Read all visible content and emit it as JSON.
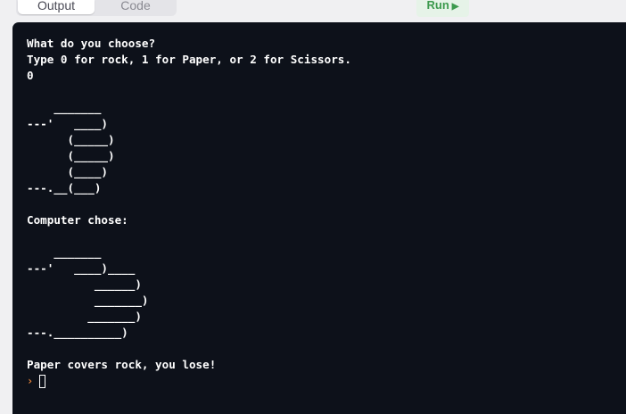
{
  "tabs": {
    "output_label": "Output",
    "code_label": "Code"
  },
  "run_button": {
    "label": "Run",
    "icon": "play-icon"
  },
  "console": {
    "background": "#0d111a",
    "lines": [
      "What do you choose?",
      "Type 0 for rock, 1 for Paper, or 2 for Scissors.",
      "0",
      "",
      "    _______",
      "---'   ____)",
      "      (_____)",
      "      (_____)",
      "      (____)",
      "---.__(___)",
      "",
      "Computer chose:",
      "",
      "    _______",
      "---'   ____)____",
      "          ______)",
      "          _______)",
      "         _______)",
      "---.__________)",
      "",
      "Paper covers rock, you lose!"
    ],
    "prompt_symbol": "›"
  }
}
